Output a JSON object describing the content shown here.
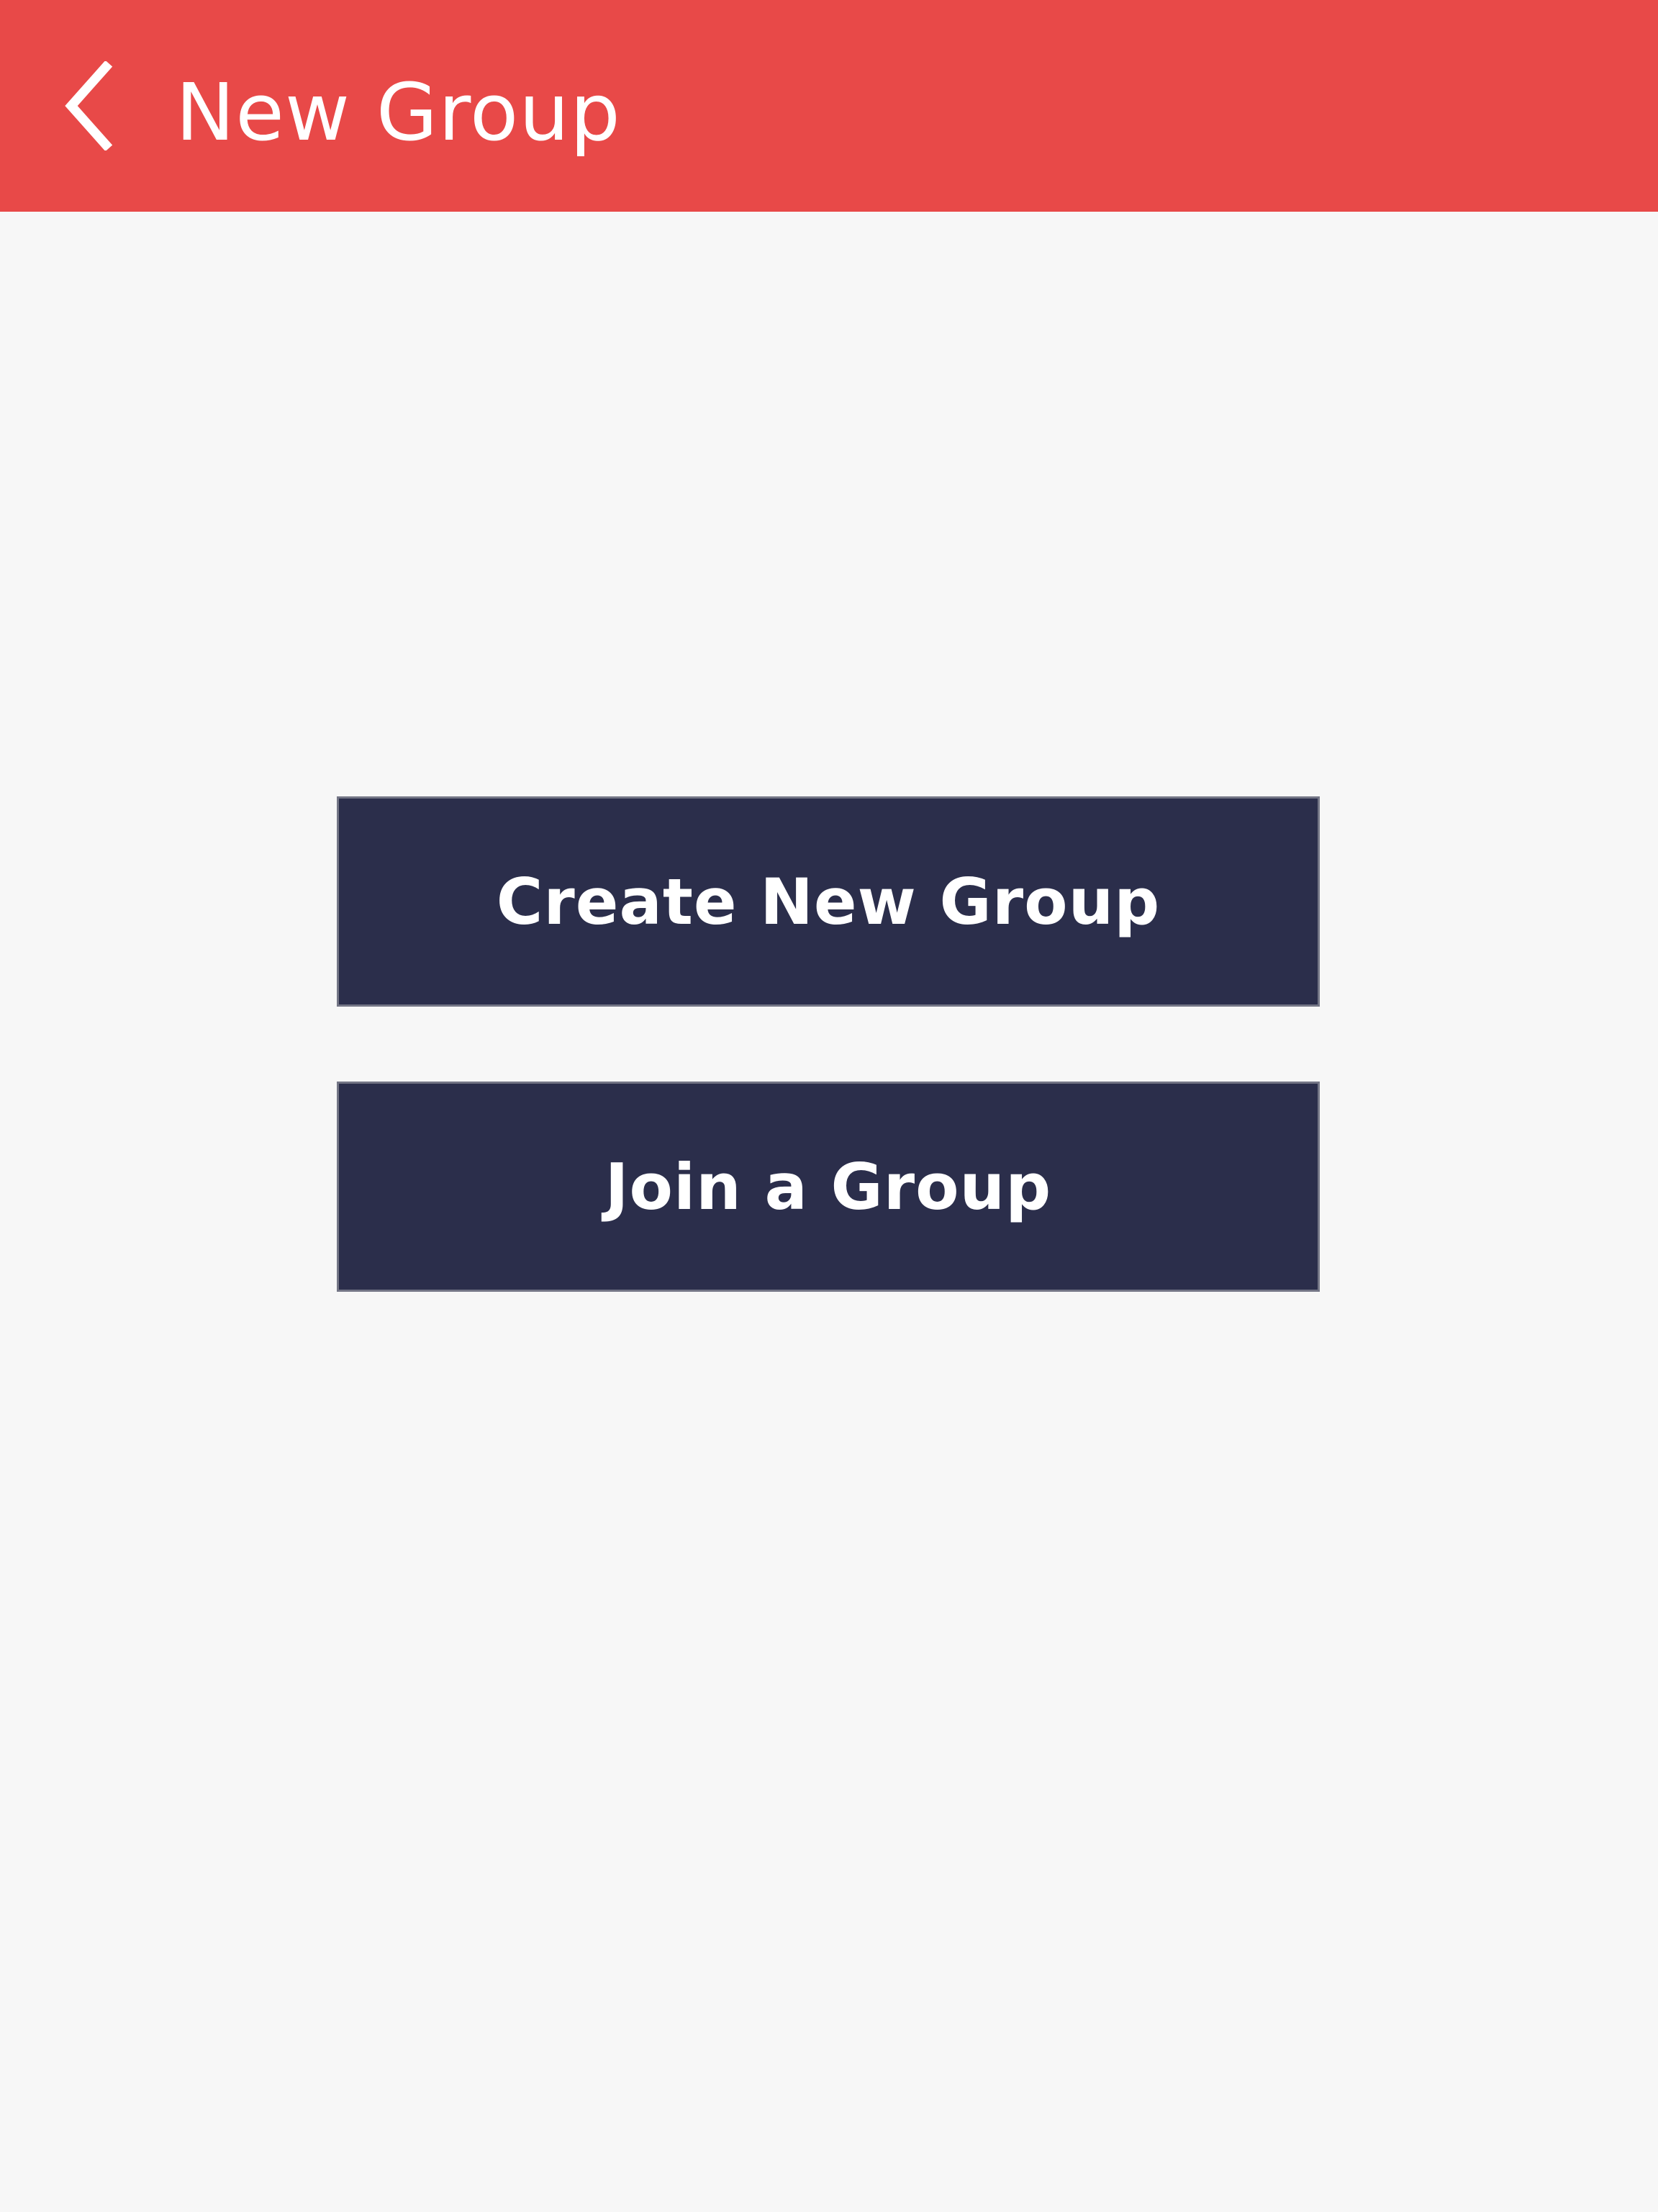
{
  "header": {
    "title": "New Group",
    "back_icon": "chevron-left-icon",
    "background_color": "#e84948",
    "text_color": "#ffffff"
  },
  "main": {
    "buttons": [
      {
        "label": "Create New Group",
        "background_color": "#2b2e4b"
      },
      {
        "label": "Join a Group",
        "background_color": "#2b2e4b"
      }
    ],
    "background_color": "#f7f7f7"
  }
}
